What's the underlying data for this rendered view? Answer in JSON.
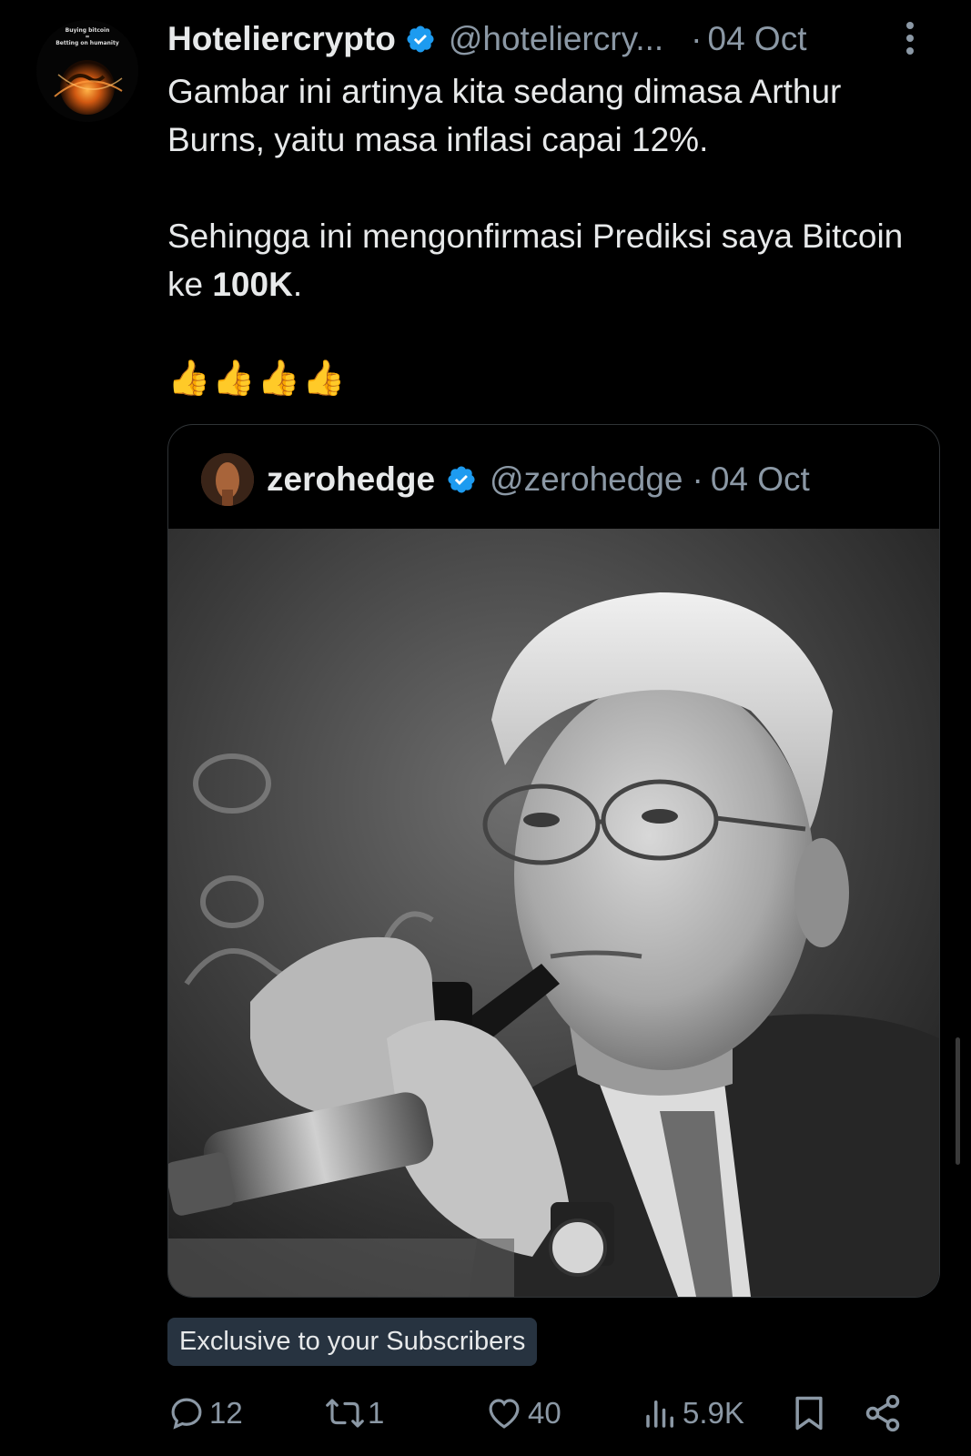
{
  "tweet": {
    "author_name": "Hoteliercrypto",
    "author_handle": "@hoteliercry...",
    "separator": "·",
    "date": "04 Oct",
    "avatar_text_line1": "Buying bitcoin",
    "avatar_text_line2": "=",
    "avatar_text_line3": "Betting on humanity",
    "text_line1": "Gambar ini artinya kita sedang dimasa Arthur Burns, yaitu masa inflasi capai 12%.",
    "text_line2_prefix": "Sehingga ini mengonfirmasi Prediksi saya Bitcoin ke ",
    "text_line2_bold": "100K",
    "text_line2_suffix": ".",
    "emojis": "👍👍👍👍"
  },
  "quoted": {
    "author_name": "zerohedge",
    "author_handle": "@zerohedge",
    "separator": "·",
    "date": "04 Oct"
  },
  "badge": "Exclusive to your Subscribers",
  "actions": {
    "replies": "12",
    "reposts": "1",
    "likes": "40",
    "views": "5.9K"
  },
  "icons": [
    "verified-badge-icon",
    "more-options-icon",
    "reply-icon",
    "repost-icon",
    "like-icon",
    "views-icon",
    "bookmark-icon",
    "share-icon"
  ],
  "colors": {
    "background": "#000000",
    "text": "#e7e9ea",
    "muted": "#8b98a5",
    "verified": "#1d9bf0",
    "badge_bg": "#273340"
  }
}
